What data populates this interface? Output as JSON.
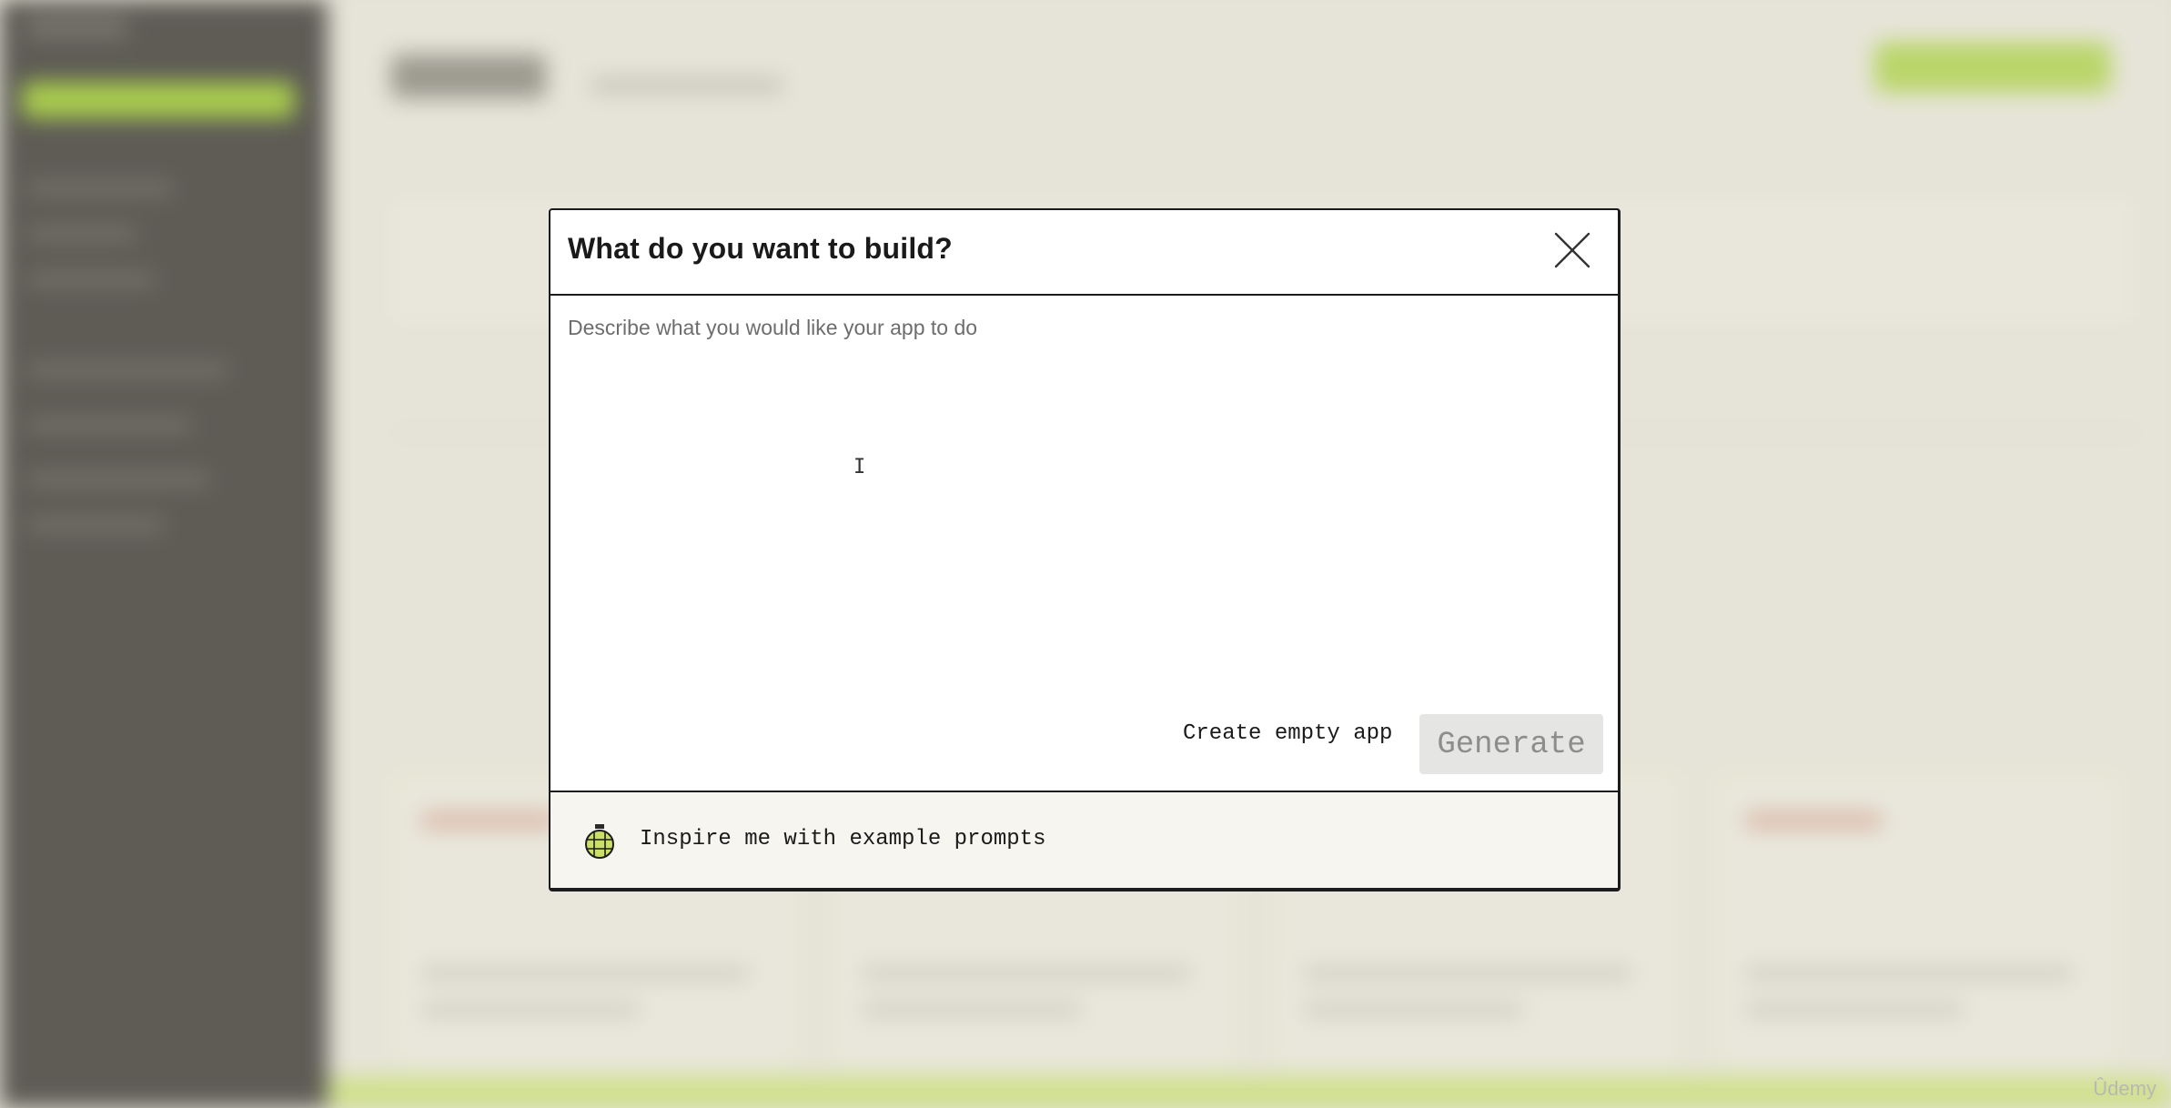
{
  "modal": {
    "title": "What do you want to build?",
    "prompt_placeholder": "Describe what you would like your app to do",
    "prompt_value": "",
    "create_empty_label": "Create empty app",
    "generate_label": "Generate",
    "inspire_label": "Inspire me with example prompts",
    "close_icon": "close-icon",
    "inspire_icon": "disco-ball-icon"
  },
  "watermark": "Ûdemy",
  "colors": {
    "sidebar": "#5e5c55",
    "accent": "#a9cc4e",
    "modal_border": "#1c1c1c",
    "footer_bg": "#f6f5f0",
    "generate_disabled_bg": "#e5e5e3"
  }
}
